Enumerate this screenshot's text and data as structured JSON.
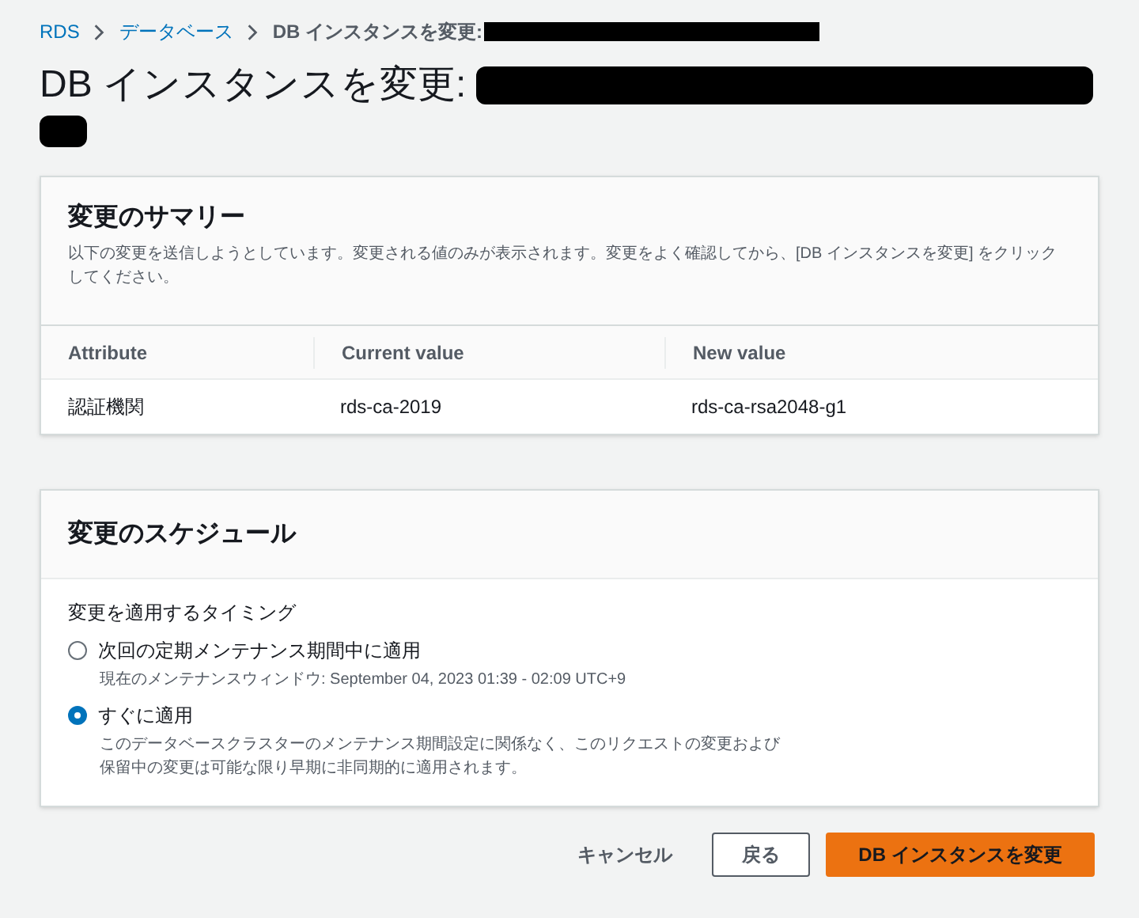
{
  "breadcrumb": [
    {
      "label": "RDS",
      "kind": "link"
    },
    {
      "label": "データベース",
      "kind": "link"
    },
    {
      "label": "DB インスタンスを変更:",
      "kind": "current"
    }
  ],
  "page_title": "DB インスタンスを変更:",
  "summary": {
    "title": "変更のサマリー",
    "description": "以下の変更を送信しようとしています。変更される値のみが表示されます。変更をよく確認してから、[DB インスタンスを変更] をクリックしてください。",
    "table": {
      "columns": [
        "Attribute",
        "Current value",
        "New value"
      ],
      "rows": [
        [
          "認証機関",
          "rds-ca-2019",
          "rds-ca-rsa2048-g1"
        ]
      ]
    }
  },
  "schedule": {
    "title": "変更のスケジュール",
    "label": "変更を適用するタイミング",
    "options": [
      {
        "label": "次回の定期メンテナンス期間中に適用",
        "description": "現在のメンテナンスウィンドウ: September 04, 2023 01:39 - 02:09 UTC+9",
        "selected": false
      },
      {
        "label": "すぐに適用",
        "description": "このデータベースクラスターのメンテナンス期間設定に関係なく、このリクエストの変更および保留中の変更は可能な限り早期に非同期的に適用されます。",
        "selected": true
      }
    ]
  },
  "buttons": [
    {
      "label": "キャンセル",
      "kind": "link"
    },
    {
      "label": "戻る",
      "kind": "normal"
    },
    {
      "label": "DB インスタンスを変更",
      "kind": "primary"
    }
  ]
}
